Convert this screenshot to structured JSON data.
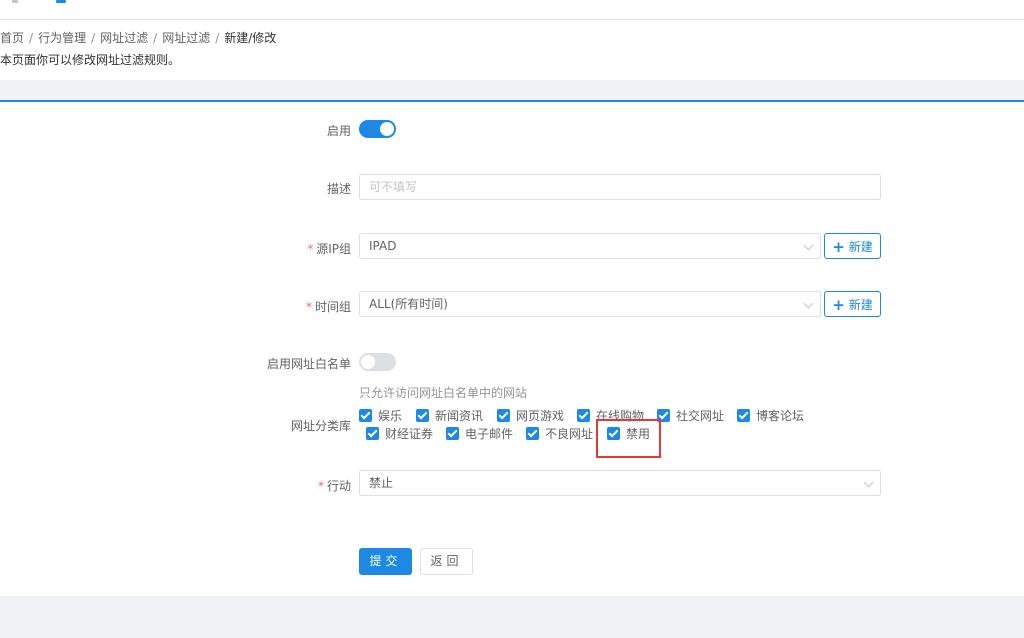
{
  "breadcrumb": {
    "items": [
      "首页",
      "行为管理",
      "网址过滤",
      "网址过滤",
      "新建/修改"
    ],
    "separator": "/"
  },
  "page": {
    "description": "本页面你可以修改网址过滤规则。"
  },
  "form": {
    "enable": {
      "label": "启用",
      "value": true
    },
    "description": {
      "label": "描述",
      "placeholder": "可不填写",
      "value": ""
    },
    "source_ip_group": {
      "label": "源IP组",
      "required_mark": "*",
      "value": "IPAD",
      "new_button": "新建"
    },
    "time_group": {
      "label": "时间组",
      "required_mark": "*",
      "value": "ALL(所有时间)",
      "new_button": "新建"
    },
    "whitelist": {
      "label": "启用网址白名单",
      "value": false,
      "hint": "只允许访问网址白名单中的网站"
    },
    "category": {
      "label": "网址分类库",
      "options": [
        {
          "label": "娱乐",
          "checked": true
        },
        {
          "label": "新闻资讯",
          "checked": true
        },
        {
          "label": "网页游戏",
          "checked": true
        },
        {
          "label": "在线购物",
          "checked": true
        },
        {
          "label": "社交网址",
          "checked": true
        },
        {
          "label": "博客论坛",
          "checked": true
        },
        {
          "label": "财经证券",
          "checked": true
        },
        {
          "label": "电子邮件",
          "checked": true
        },
        {
          "label": "不良网址",
          "checked": true
        },
        {
          "label": "禁用",
          "checked": true
        }
      ]
    },
    "action": {
      "label": "行动",
      "required_mark": "*",
      "value": "禁止"
    },
    "submit_button": "提交",
    "back_button": "返回"
  },
  "colors": {
    "primary": "#1e88e5",
    "required": "#f56c6c",
    "highlight": "#e53935"
  }
}
